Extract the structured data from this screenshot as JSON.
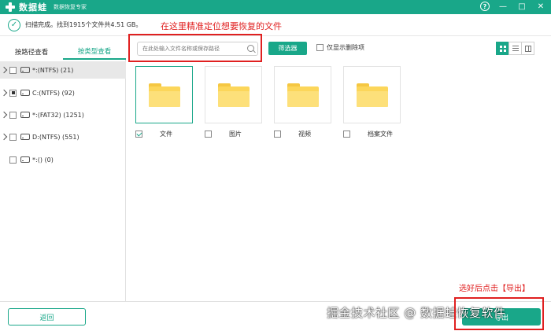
{
  "titlebar": {
    "app_name": "数据蛙",
    "app_subtitle": "数据恢复专家",
    "help": "?",
    "minimize": "—",
    "maximize": "□",
    "close": "✕"
  },
  "status": {
    "text": "扫描完成。找到1915个文件共4.51 GB。"
  },
  "annotations": {
    "top": "在这里精准定位想要恢复的文件",
    "bottom": "选好后点击【导出】"
  },
  "tabs": [
    {
      "label": "按路径查看",
      "active": false
    },
    {
      "label": "按类型查看",
      "active": true
    }
  ],
  "search": {
    "placeholder": "在此处输入文件名称或保存路径"
  },
  "toolbar": {
    "filter_label": "筛选器",
    "deleted_only_label": "仅显示删除项"
  },
  "drives": [
    {
      "label": "*:(NTFS) (21)",
      "selected": true,
      "state": "none",
      "expandable": true
    },
    {
      "label": "C:(NTFS) (92)",
      "selected": false,
      "state": "partial",
      "expandable": true
    },
    {
      "label": "*:(FAT32) (1251)",
      "selected": false,
      "state": "none",
      "expandable": true
    },
    {
      "label": "D:(NTFS) (551)",
      "selected": false,
      "state": "none",
      "expandable": true
    },
    {
      "label": "*:() (0)",
      "selected": false,
      "state": "none",
      "expandable": false
    }
  ],
  "categories": [
    {
      "label": "文件",
      "checked": true,
      "selected": true
    },
    {
      "label": "图片",
      "checked": false,
      "selected": false
    },
    {
      "label": "视频",
      "checked": false,
      "selected": false
    },
    {
      "label": "档案文件",
      "checked": false,
      "selected": false
    }
  ],
  "footer": {
    "back_label": "返回",
    "export_label": "导出"
  },
  "watermark": "掘金技术社区 @ 数据蛙恢复软件",
  "colors": {
    "accent": "#19a789",
    "annotation": "#e02020",
    "folder": "#fcd65a"
  }
}
